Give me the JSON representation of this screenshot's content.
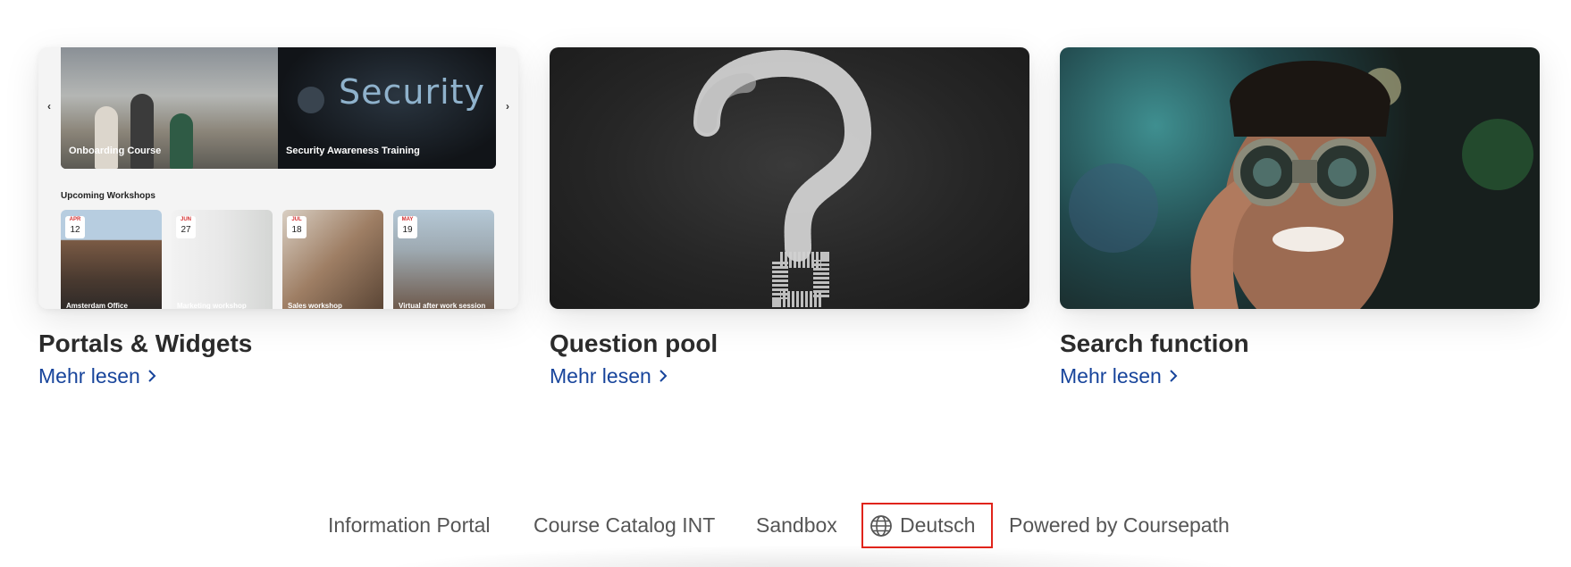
{
  "cards": [
    {
      "title": "Portals & Widgets",
      "link": "Mehr lesen",
      "preview": {
        "slides": [
          "Onboarding Course",
          "Security Awareness Training"
        ],
        "banner_word": "Security",
        "section_title": "Upcoming Workshops",
        "workshops": [
          {
            "month": "APR",
            "day": "12",
            "label": "Amsterdam Office"
          },
          {
            "month": "JUN",
            "day": "27",
            "label": "Marketing workshop"
          },
          {
            "month": "JUL",
            "day": "18",
            "label": "Sales workshop"
          },
          {
            "month": "MAY",
            "day": "19",
            "label": "Virtual after work session"
          }
        ]
      }
    },
    {
      "title": "Question pool",
      "link": "Mehr lesen"
    },
    {
      "title": "Search function",
      "link": "Mehr lesen"
    }
  ],
  "footer": {
    "links": [
      "Information Portal",
      "Course Catalog INT",
      "Sandbox"
    ],
    "language": "Deutsch",
    "powered_by": "Powered by Coursepath"
  },
  "colors": {
    "link": "#17449b",
    "highlight": "#e0241b"
  },
  "icons": {
    "nav_prev": "chevron-left-icon",
    "nav_next": "chevron-right-icon",
    "link_arrow": "chevron-right-icon",
    "language": "globe-icon"
  }
}
